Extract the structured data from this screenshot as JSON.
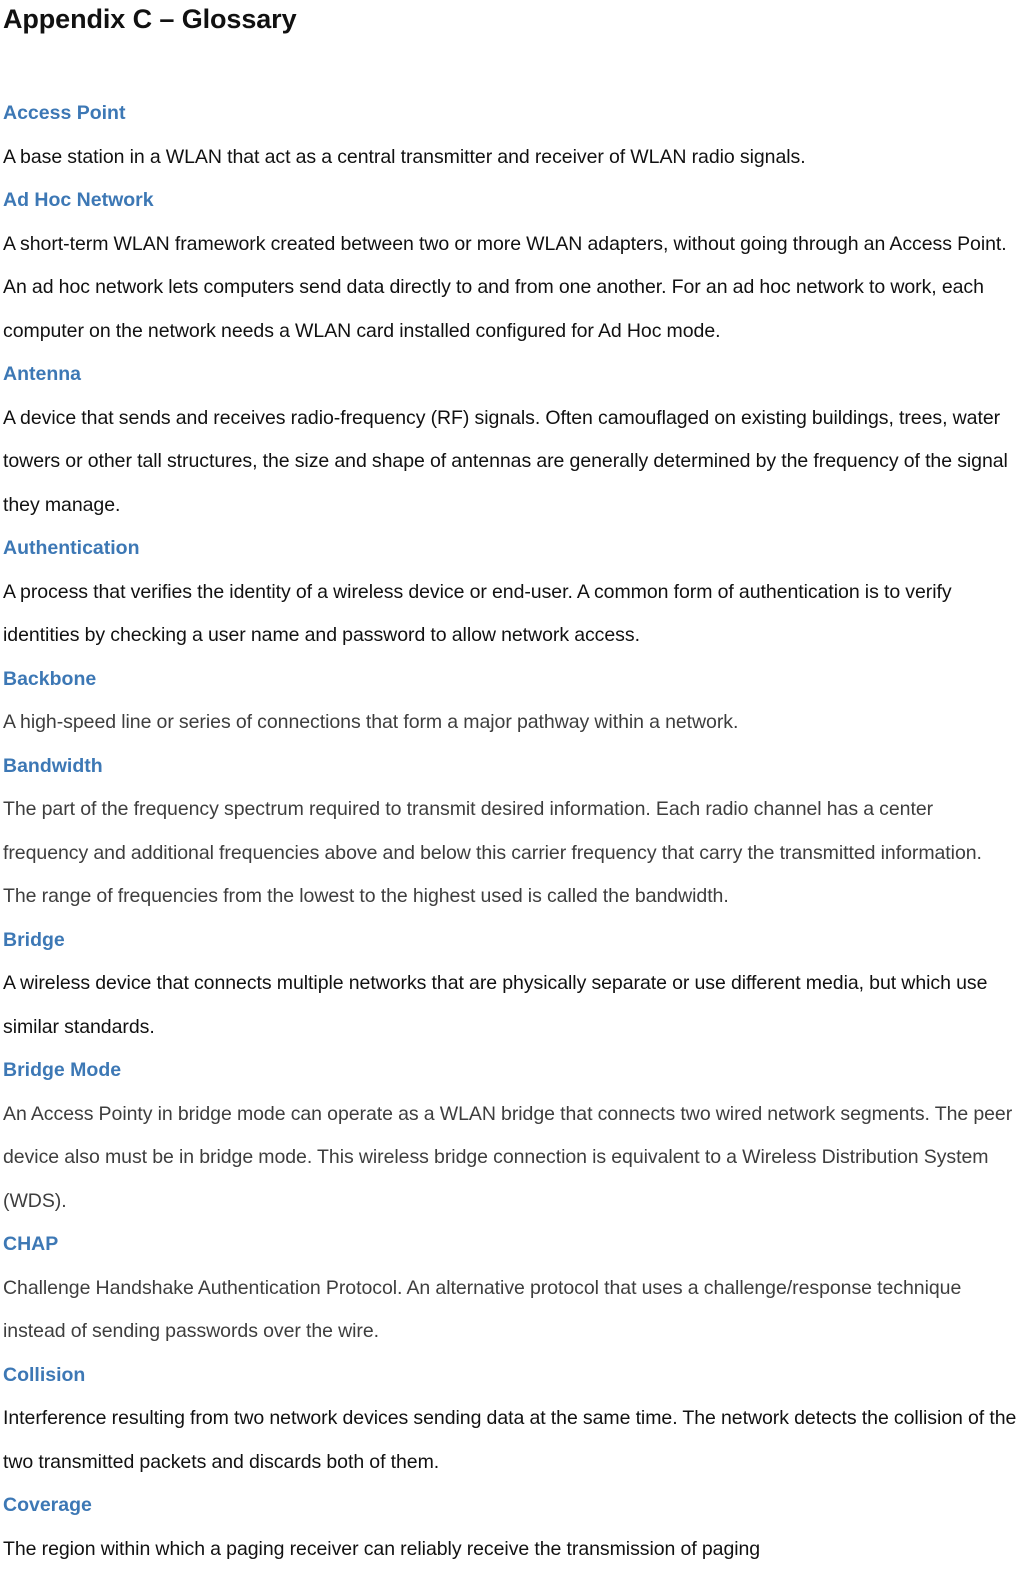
{
  "document": {
    "title": "Appendix C – Glossary",
    "accent_color": "#3d78b5",
    "body_color": "#111111",
    "body_color_light": "#3e3e3e"
  },
  "glossary": {
    "entries": [
      {
        "term": "Access Point",
        "definition": "A base station in a WLAN that act as a central transmitter and receiver of WLAN radio signals.",
        "tone": "dark"
      },
      {
        "term": "Ad Hoc Network",
        "definition": "A short-term WLAN framework created between two or more WLAN adapters, without going through an Access Point. An ad hoc network lets computers send data directly to and from one another. For an ad hoc network to work, each computer on the network needs a WLAN card installed configured for Ad Hoc mode.",
        "tone": "dark"
      },
      {
        "term": "Antenna",
        "definition": "A device that sends and receives radio-frequency (RF) signals. Often camouflaged on existing buildings, trees, water towers or other tall structures, the size and shape of antennas are generally determined by the frequency of the signal they manage.",
        "tone": "dark"
      },
      {
        "term": "Authentication",
        "definition": "A process that verifies the identity of a wireless device or end-user. A common form of authentication is to verify identities by checking a user name and password to allow network access.",
        "tone": "dark"
      },
      {
        "term": "Backbone",
        "definition": "A high-speed line or series of connections that form a major pathway within a network.",
        "tone": "light"
      },
      {
        "term": "Bandwidth",
        "definition": "The part of the frequency spectrum required to transmit desired information. Each radio channel has a center frequency and additional frequencies above and below this carrier frequency that carry the transmitted information. The range of frequencies from the lowest to the highest used is called the bandwidth.",
        "tone": "light"
      },
      {
        "term": "Bridge",
        "definition": "A wireless device that connects multiple networks that are physically separate or use different media, but which use similar standards.",
        "tone": "dark"
      },
      {
        "term": "Bridge Mode",
        "definition": "An Access Pointy in bridge mode can operate as a WLAN bridge that connects two wired network segments. The peer device also must be in bridge mode. This wireless bridge connection is equivalent to a Wireless Distribution System (WDS).",
        "tone": "light"
      },
      {
        "term": "CHAP",
        "definition": "Challenge Handshake Authentication Protocol. An alternative protocol that uses a challenge/response technique instead of sending passwords over the wire.",
        "tone": "light"
      },
      {
        "term": "Collision",
        "definition": "Interference resulting from two network devices sending data at the same time. The network detects the collision of the two transmitted packets and discards both of them.",
        "tone": "dark"
      },
      {
        "term": "Coverage",
        "definition": "The region within which a paging receiver can reliably receive the transmission of paging",
        "tone": "dark"
      }
    ]
  }
}
